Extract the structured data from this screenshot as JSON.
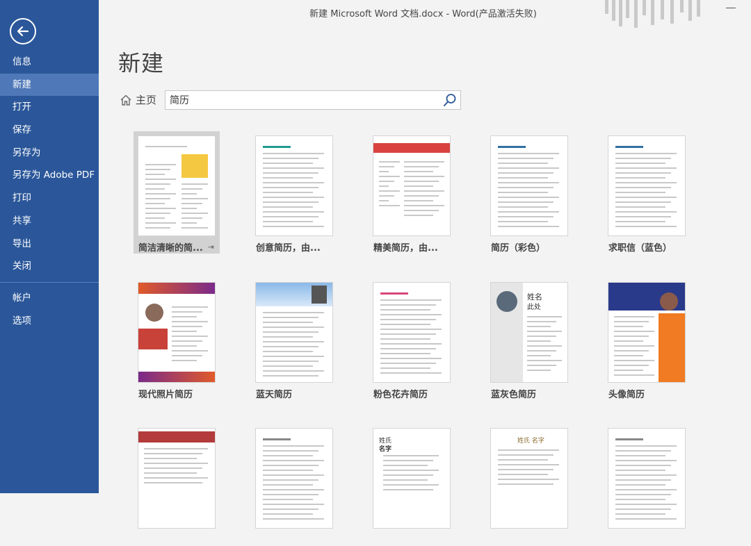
{
  "titlebar": {
    "text": "新建 Microsoft Word 文档.docx - Word(产品激活失败)"
  },
  "sidebar": {
    "back_icon": "back-arrow-icon",
    "items": [
      {
        "label": "信息"
      },
      {
        "label": "新建"
      },
      {
        "label": "打开"
      },
      {
        "label": "保存"
      },
      {
        "label": "另存为"
      },
      {
        "label": "另存为 Adobe PDF"
      },
      {
        "label": "打印"
      },
      {
        "label": "共享"
      },
      {
        "label": "导出"
      },
      {
        "label": "关闭"
      },
      {
        "label": "帐户"
      },
      {
        "label": "选项"
      }
    ],
    "active_index": 1
  },
  "main": {
    "title": "新建",
    "home_label": "主页",
    "search": {
      "value": "简历",
      "icon": "search-icon"
    }
  },
  "templates": [
    {
      "label": "简洁清晰的简...",
      "selected": true,
      "pinned": true,
      "accent": "#f5c842"
    },
    {
      "label": "创意简历，由...",
      "accent": "#1f9a8f"
    },
    {
      "label": "精美简历，由...",
      "accent": "#d9433f"
    },
    {
      "label": "简历（彩色）",
      "accent": "#2f6fa3"
    },
    {
      "label": "求职信（蓝色）",
      "accent": "#2f6fa3"
    },
    {
      "label": "现代照片简历",
      "accent": "#c9423a"
    },
    {
      "label": "蓝天简历",
      "accent": "#3a7bc4"
    },
    {
      "label": "粉色花卉简历",
      "accent": "#d9457a"
    },
    {
      "label": "蓝灰色简历",
      "accent": "#6a8caf"
    },
    {
      "label": "头像简历",
      "accent": "#f07b22"
    },
    {
      "label": "",
      "accent": "#b33b3b"
    },
    {
      "label": "",
      "accent": "#888888"
    },
    {
      "label": "",
      "accent": "#5a3b7a"
    },
    {
      "label": "",
      "accent": "#8a6a2a"
    },
    {
      "label": "",
      "accent": "#888888"
    }
  ],
  "thumb_text": {
    "t4_name": "姓名",
    "t4_sub": "此处",
    "t13_a": "姓氏",
    "t13_b": "名字",
    "t14_a": "姓氏",
    "t14_b": "名字"
  }
}
